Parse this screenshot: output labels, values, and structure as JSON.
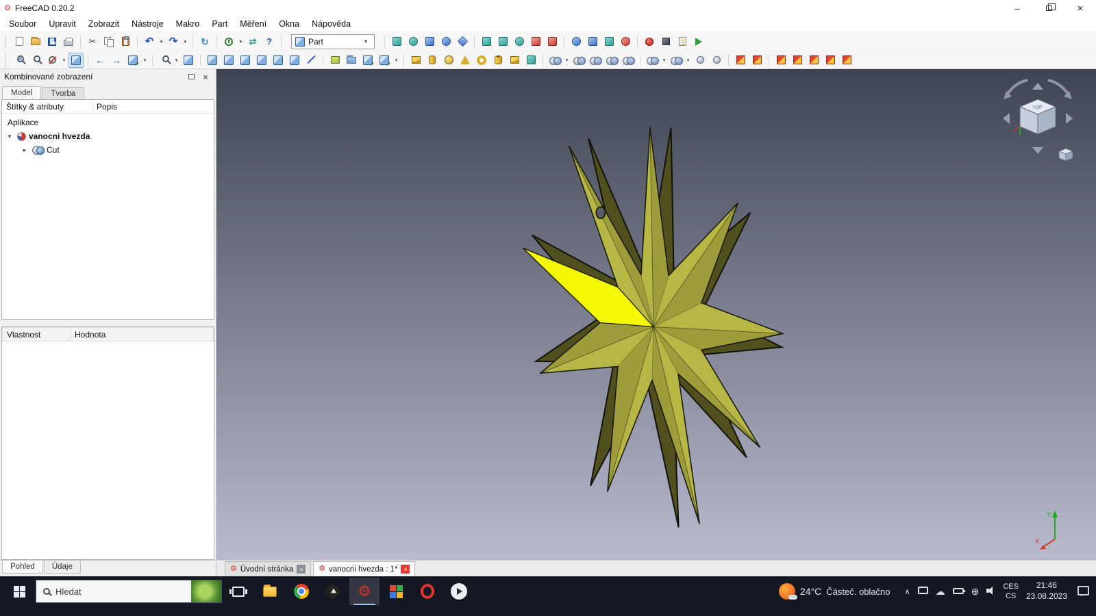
{
  "window": {
    "title": "FreeCAD 0.20.2"
  },
  "menubar": [
    "Soubor",
    "Upravit",
    "Zobrazit",
    "Nástroje",
    "Makro",
    "Part",
    "Měření",
    "Okna",
    "Nápověda"
  ],
  "toolbar": {
    "workbench_selected": "Part"
  },
  "combo_view": {
    "title": "Kombinované zobrazení",
    "tabs": {
      "model": "Model",
      "creation": "Tvorba"
    },
    "tree_columns": {
      "labels": "Štítky & atributy",
      "description": "Popis"
    },
    "tree": {
      "root": "Aplikace",
      "document": "vanocni hvezda",
      "child": "Cut"
    },
    "props_columns": {
      "property": "Vlastnost",
      "value": "Hodnota"
    },
    "bottom_tabs": {
      "view": "Pohled",
      "data": "Údaje"
    }
  },
  "doc_tabs": {
    "start_page": "Úvodní stránka",
    "document": "vanocni hvezda : 1*"
  },
  "viewport": {
    "colors": {
      "background_top": "#3f4452",
      "background_bottom": "#b8bbce",
      "star_front": "#b7b746",
      "star_back": "#50501e",
      "star_highlight": "#f4fa05",
      "star_edge": "#1a1a0c"
    },
    "navcube_label": "TOP",
    "axis": {
      "x": "X",
      "y": "Y"
    }
  },
  "taskbar": {
    "search_placeholder": "Hledat",
    "weather": {
      "temperature": "24°C",
      "condition": "Částeč. oblačno"
    },
    "language": {
      "primary": "CES",
      "secondary": "CS"
    },
    "clock": {
      "time": "21:46",
      "date": "23.08.2023"
    }
  },
  "icons": {
    "freecad-logo": "red gear ⚙",
    "new-document": "blank page",
    "open-document": "yellow folder",
    "save-document": "blue floppy disk",
    "print": "printer",
    "cut": "scissors ✂",
    "copy": "two pages",
    "paste": "clipboard",
    "undo": "↶",
    "redo": "↷",
    "refresh": "↻",
    "view-cube": "blue shaded cube",
    "magnifier": "magnifying glass",
    "record-macro": "red circle",
    "stop-macro": "dark square",
    "execute-macro": "green play triangle",
    "part-primitive": "yellow solid shape",
    "boolean-operation": "two overlapping gray/blue spheres",
    "measure-tool": "red/yellow gauge square",
    "windows-start": "four window panes",
    "task-view": "stacked rectangles",
    "file-explorer": "yellow folder",
    "chrome": "multicolor ring with blue center",
    "opera": "red ring",
    "cloud": "☁",
    "network": "⊕",
    "chevron-up": "∧",
    "weather": "orange sun behind cloud"
  }
}
